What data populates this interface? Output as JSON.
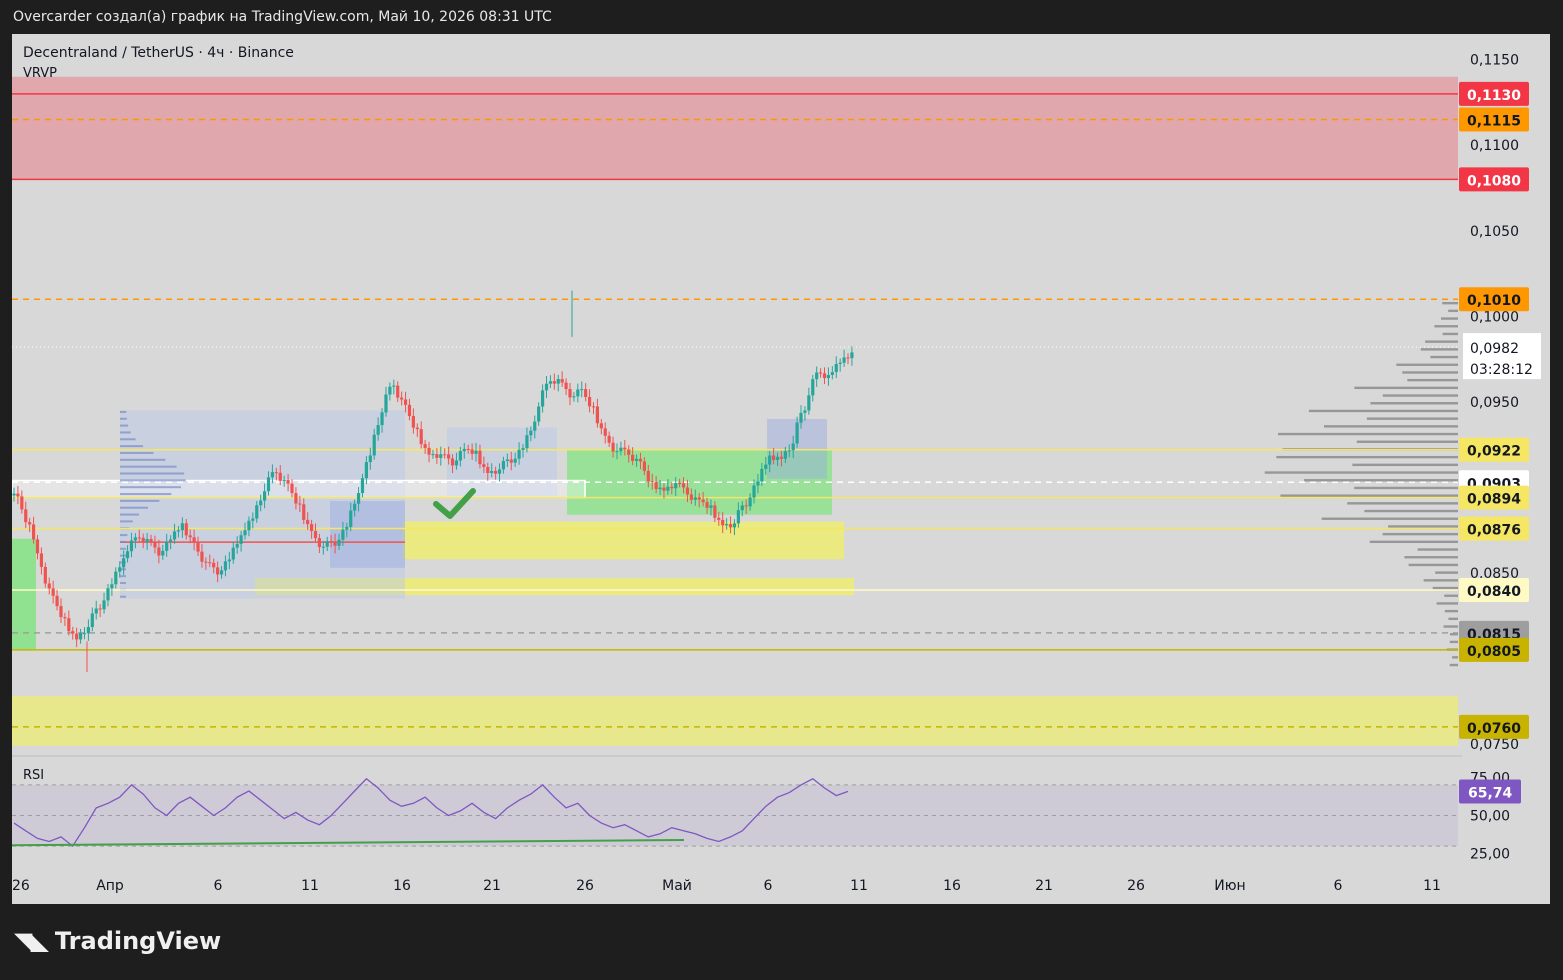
{
  "header": {
    "caption": "Overcarder создал(а) график на TradingView.com, Май 10, 2026 08:31 UTC"
  },
  "legend": {
    "symbol_line": "Decentraland / TetherUS · 4ч · Binance",
    "indicator": "VRVP",
    "rsi_label": "RSI"
  },
  "brand": {
    "name": "TradingView"
  },
  "colors": {
    "bg": "#d8d8d8",
    "up": "#26a69a",
    "down": "#ef5350",
    "resistance": "#f23645",
    "orange": "#ff9800",
    "yellow_zone": "#f0f07a",
    "green_zone": "#8fe08f",
    "rsi": "#7e57c2"
  },
  "chart_data": [
    {
      "type": "candlestick",
      "title": "Decentraland / TetherUS · 4ч · Binance",
      "price_axis_ticks": [
        "0,1150",
        "0,1100",
        "0,1050",
        "0,1000",
        "0,0950",
        "0,0850",
        "0,0750"
      ],
      "ylim": [
        0.0743,
        0.1165
      ],
      "time_axis_ticks": [
        "26",
        "Апр",
        "6",
        "11",
        "16",
        "21",
        "26",
        "Май",
        "6",
        "11",
        "16",
        "21",
        "26",
        "Июн",
        "6",
        "11"
      ],
      "last_price": {
        "value": "0,0982",
        "countdown": "03:28:12"
      },
      "price_labels": [
        {
          "value": "0,1130",
          "price": 0.113,
          "color": "#f23645",
          "text_color": "#ffffff"
        },
        {
          "value": "0,1115",
          "price": 0.1115,
          "color": "#ff9800",
          "text_color": "#131722"
        },
        {
          "value": "0,1080",
          "price": 0.108,
          "color": "#f23645",
          "text_color": "#ffffff"
        },
        {
          "value": "0,1010",
          "price": 0.101,
          "color": "#ff9800",
          "text_color": "#131722"
        },
        {
          "value": "0,0922",
          "price": 0.0922,
          "color": "#f5e663",
          "text_color": "#131722"
        },
        {
          "value": "0,0903",
          "price": 0.0903,
          "color": "#ffffff",
          "text_color": "#131722"
        },
        {
          "value": "0,0894",
          "price": 0.0894,
          "color": "#f5e663",
          "text_color": "#131722"
        },
        {
          "value": "0,0876",
          "price": 0.0876,
          "color": "#f5e663",
          "text_color": "#131722"
        },
        {
          "value": "0,0840",
          "price": 0.084,
          "color": "#fff9c4",
          "text_color": "#131722"
        },
        {
          "value": "0,0815",
          "price": 0.0815,
          "color": "#9e9e9e",
          "text_color": "#131722"
        },
        {
          "value": "0,0805",
          "price": 0.0805,
          "color": "#c8b400",
          "text_color": "#131722"
        },
        {
          "value": "0,0760",
          "price": 0.076,
          "color": "#c8b400",
          "text_color": "#131722"
        }
      ],
      "horizontal_lines": [
        {
          "price": 0.113,
          "style": "solid",
          "color": "#f23645"
        },
        {
          "price": 0.1115,
          "style": "dashed",
          "color": "#ff9800"
        },
        {
          "price": 0.108,
          "style": "solid",
          "color": "#f23645"
        },
        {
          "price": 0.101,
          "style": "dashed",
          "color": "#ff9800"
        },
        {
          "price": 0.0922,
          "style": "solid",
          "color": "#f5e663"
        },
        {
          "price": 0.0903,
          "style": "dashed",
          "color": "#ffffff"
        },
        {
          "price": 0.0894,
          "style": "solid",
          "color": "#f5e663"
        },
        {
          "price": 0.0876,
          "style": "solid",
          "color": "#f5e663"
        },
        {
          "price": 0.084,
          "style": "solid",
          "color": "#fff9c4"
        },
        {
          "price": 0.0815,
          "style": "dashed",
          "color": "#9e9e9e"
        },
        {
          "price": 0.0805,
          "style": "solid",
          "color": "#c8b400"
        },
        {
          "price": 0.076,
          "style": "dashed",
          "color": "#c8b400"
        }
      ],
      "zones": [
        {
          "kind": "resistance",
          "price_top": 0.114,
          "price_bottom": 0.108
        },
        {
          "kind": "demand",
          "price_top": 0.0778,
          "price_bottom": 0.0749
        },
        {
          "kind": "demand",
          "price_top": 0.088,
          "price_bottom": 0.0858
        },
        {
          "kind": "demand",
          "price_top": 0.0847,
          "price_bottom": 0.0837
        },
        {
          "kind": "support",
          "price_top": 0.0922,
          "price_bottom": 0.0884
        }
      ],
      "candles_close_sampled": [
        0.0895,
        0.0872,
        0.0845,
        0.0828,
        0.0815,
        0.0808,
        0.0822,
        0.0835,
        0.0848,
        0.0862,
        0.0878,
        0.087,
        0.0858,
        0.0872,
        0.088,
        0.0865,
        0.0852,
        0.0848,
        0.086,
        0.0875,
        0.0888,
        0.0905,
        0.0915,
        0.0898,
        0.0882,
        0.087,
        0.0862,
        0.0868,
        0.088,
        0.0902,
        0.093,
        0.0955,
        0.0968,
        0.0942,
        0.0925,
        0.0915,
        0.092,
        0.0912,
        0.0925,
        0.0918,
        0.0905,
        0.0912,
        0.0918,
        0.0925,
        0.0942,
        0.0972,
        0.0965,
        0.095,
        0.0958,
        0.094,
        0.0925,
        0.0918,
        0.092,
        0.0912,
        0.0895,
        0.0898,
        0.0905,
        0.0895,
        0.089,
        0.0885,
        0.0875,
        0.088,
        0.0895,
        0.0908,
        0.0922,
        0.0918,
        0.093,
        0.0955,
        0.0975,
        0.0962,
        0.0978,
        0.0982
      ],
      "rsi": {
        "label": "RSI",
        "value": "65,74",
        "ticks": [
          "75,00",
          "50,00",
          "25,00"
        ],
        "ylim": [
          15,
          85
        ],
        "values": [
          45,
          40,
          35,
          33,
          36,
          30,
          42,
          55,
          58,
          62,
          70,
          64,
          55,
          50,
          58,
          62,
          56,
          50,
          55,
          62,
          66,
          60,
          54,
          48,
          52,
          47,
          44,
          50,
          58,
          66,
          74,
          68,
          60,
          56,
          58,
          62,
          55,
          50,
          53,
          58,
          52,
          48,
          55,
          60,
          64,
          70,
          62,
          55,
          58,
          50,
          45,
          42,
          44,
          40,
          36,
          38,
          42,
          40,
          38,
          35,
          33,
          36,
          40,
          48,
          56,
          62,
          65,
          70,
          74,
          68,
          63,
          65.74
        ]
      }
    }
  ]
}
